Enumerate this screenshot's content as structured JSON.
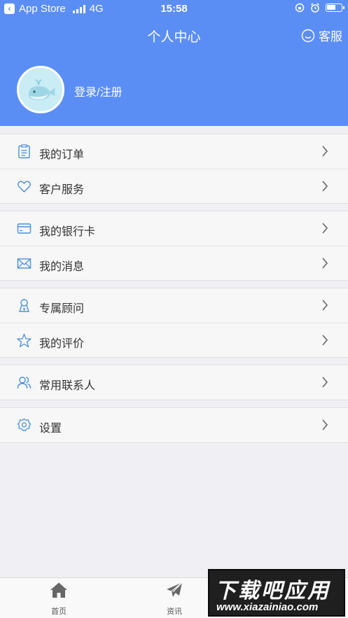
{
  "status_bar": {
    "back_app": "App Store",
    "network": "4G",
    "time": "15:58"
  },
  "header": {
    "title": "个人中心",
    "service_label": "客服",
    "login_label": "登录/注册"
  },
  "menu_groups": [
    [
      {
        "label": "我的订单",
        "icon": "order-list-icon"
      },
      {
        "label": "客户服务",
        "icon": "heart-icon"
      }
    ],
    [
      {
        "label": "我的银行卡",
        "icon": "bank-card-icon"
      },
      {
        "label": "我的消息",
        "icon": "envelope-icon"
      }
    ],
    [
      {
        "label": "专属顾问",
        "icon": "advisor-icon"
      },
      {
        "label": "我的评价",
        "icon": "star-icon"
      }
    ],
    [
      {
        "label": "常用联系人",
        "icon": "contacts-icon"
      }
    ],
    [
      {
        "label": "设置",
        "icon": "gear-icon"
      }
    ]
  ],
  "tabbar": {
    "tabs": [
      {
        "label": "首页",
        "icon": "home-icon"
      },
      {
        "label": "资讯",
        "icon": "paper-plane-icon"
      }
    ]
  },
  "watermark": {
    "line1": "下载吧应用",
    "line2": "www.xiazainiao.com"
  },
  "colors": {
    "header_bg": "#5b8ef5",
    "icon_blue": "#4a90d9",
    "page_bg": "#efeff4"
  }
}
